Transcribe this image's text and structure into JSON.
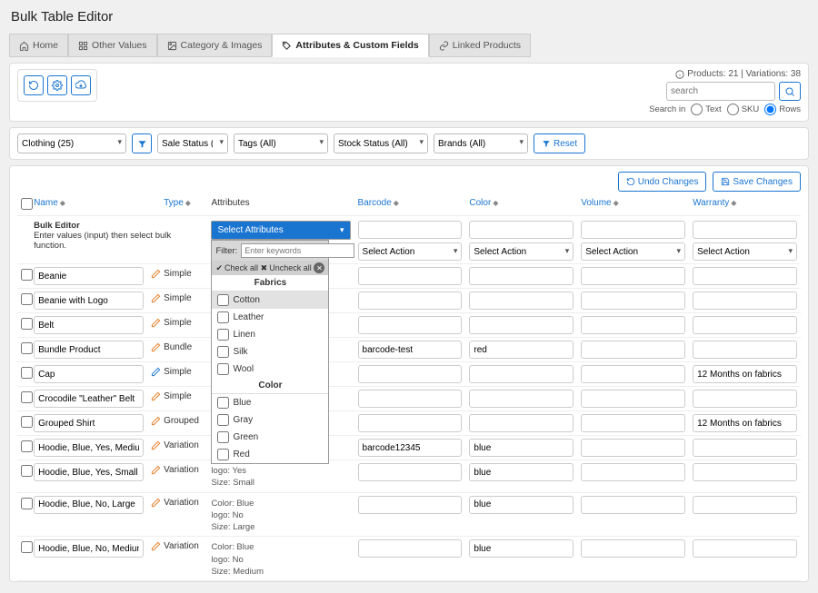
{
  "title": "Bulk Table Editor",
  "tabs": [
    {
      "label": "Home",
      "icon": "home"
    },
    {
      "label": "Other Values",
      "icon": "grid"
    },
    {
      "label": "Category & Images",
      "icon": "image"
    },
    {
      "label": "Attributes & Custom Fields",
      "icon": "tag",
      "active": true
    },
    {
      "label": "Linked Products",
      "icon": "link"
    }
  ],
  "stats": "Products: 21 | Variations: 38",
  "search_placeholder": "search",
  "search_in_label": "Search in",
  "search_radios": [
    "Text",
    "SKU",
    "Rows"
  ],
  "filters": {
    "category": "Clothing  (25)",
    "sale_status": "Sale Status ( All )",
    "tags": "Tags (All)",
    "stock_status": "Stock Status (All)",
    "brands": "Brands (All)",
    "reset": "Reset"
  },
  "undo": "Undo Changes",
  "save": "Save Changes",
  "columns": {
    "name": "Name",
    "type": "Type",
    "attributes": "Attributes",
    "barcode": "Barcode",
    "color": "Color",
    "volume": "Volume",
    "warranty": "Warranty"
  },
  "bulk_editor": {
    "title": "Bulk Editor",
    "desc": "Enter values (input) then select bulk function."
  },
  "attr_popup": {
    "head": "Select Attributes",
    "filter_label": "Filter:",
    "filter_placeholder": "Enter keywords",
    "check_all": "Check all",
    "uncheck_all": "Uncheck all",
    "groups": [
      {
        "name": "Fabrics",
        "items": [
          "Cotton",
          "Leather",
          "Linen",
          "Silk",
          "Wool"
        ]
      },
      {
        "name": "Color",
        "items": [
          "Blue",
          "Gray",
          "Green",
          "Red"
        ]
      }
    ]
  },
  "select_action": "Select Action",
  "rows": [
    {
      "name": "Beanie",
      "type": "Simple",
      "attrs": [],
      "barcode": "",
      "color": "",
      "volume": "",
      "warranty": ""
    },
    {
      "name": "Beanie with Logo",
      "type": "Simple",
      "attrs": [],
      "barcode": "",
      "color": "",
      "volume": "",
      "warranty": ""
    },
    {
      "name": "Belt",
      "type": "Simple",
      "attrs": [],
      "barcode": "",
      "color": "",
      "volume": "",
      "warranty": ""
    },
    {
      "name": "Bundle Product",
      "type": "Bundle",
      "attrs": [],
      "barcode": "barcode-test",
      "color": "red",
      "volume": "",
      "warranty": ""
    },
    {
      "name": "Cap",
      "type": "Simple",
      "edit_blue": true,
      "attrs": [],
      "barcode": "",
      "color": "",
      "volume": "",
      "warranty": "12 Months on fabrics"
    },
    {
      "name": "Crocodile \"Leather\" Belt",
      "type": "Simple",
      "attrs": [],
      "barcode": "",
      "color": "",
      "volume": "",
      "warranty": ""
    },
    {
      "name": "Grouped Shirt",
      "type": "Grouped",
      "attrs": [],
      "barcode": "",
      "color": "",
      "volume": "",
      "warranty": "12 Months on fabrics"
    },
    {
      "name": "Hoodie, Blue, Yes, Medium",
      "type": "Variation",
      "attrs": [],
      "barcode": "barcode12345",
      "color": "blue",
      "volume": "",
      "warranty": ""
    },
    {
      "name": "Hoodie, Blue, Yes, Small",
      "type": "Variation",
      "attrs": [
        "logo: Yes",
        "Size: Small"
      ],
      "barcode": "",
      "color": "blue",
      "volume": "",
      "warranty": ""
    },
    {
      "name": "Hoodie, Blue, No, Large",
      "type": "Variation",
      "attrs": [
        "Color: Blue",
        "logo: No",
        "Size: Large"
      ],
      "barcode": "",
      "color": "blue",
      "volume": "",
      "warranty": ""
    },
    {
      "name": "Hoodie, Blue, No, Medium",
      "type": "Variation",
      "attrs": [
        "Color: Blue",
        "logo: No",
        "Size: Medium"
      ],
      "barcode": "",
      "color": "blue",
      "volume": "",
      "warranty": ""
    }
  ]
}
